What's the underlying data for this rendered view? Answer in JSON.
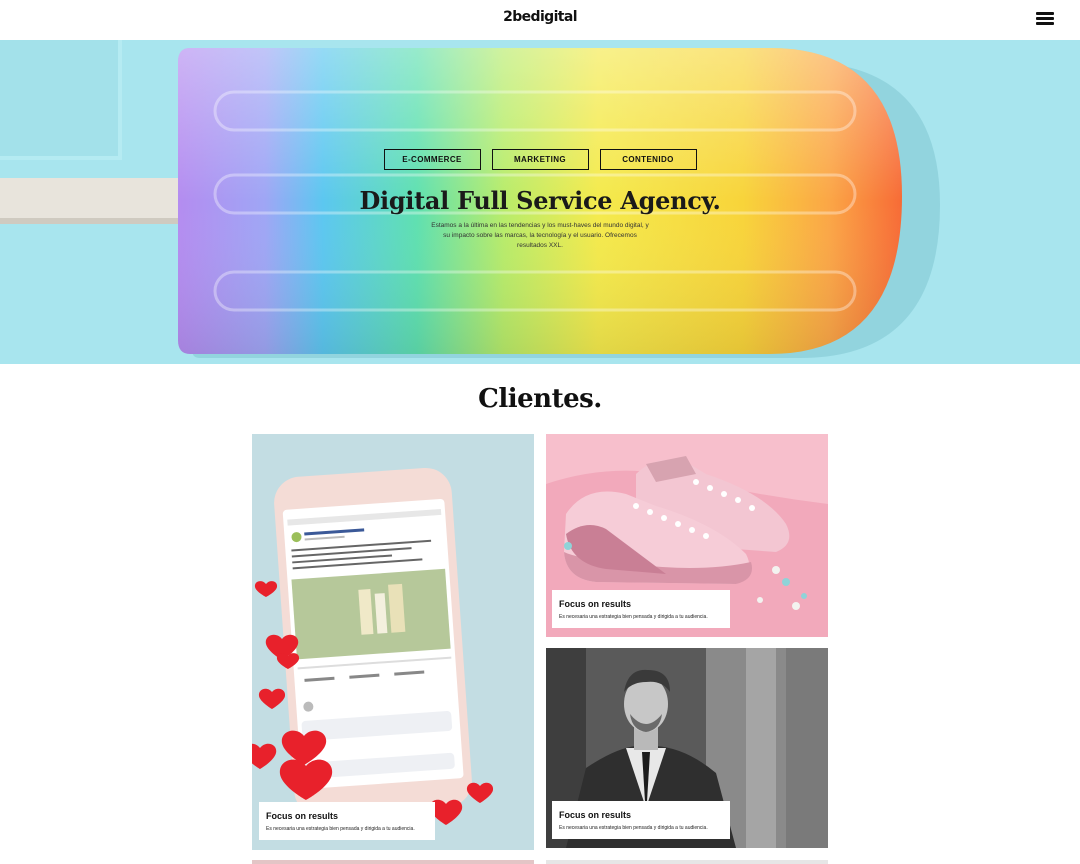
{
  "header": {
    "logo": "2bedigital"
  },
  "hero": {
    "tags": [
      "E-COMMERCE",
      "MARKETING",
      "CONTENIDO"
    ],
    "title": "Digital Full Service Agency.",
    "description": "Estamos a la última en las tendencias y los must-haves del mundo digital, y su impacto sobre las marcas, la tecnología y el usuario. Ofrecemos resultados XXL."
  },
  "clients": {
    "title": "Clientes.",
    "cards": [
      {
        "title": "Focus on results",
        "desc": "Es necesaria una estrategia bien pensada y dirigida a tu audiencia."
      },
      {
        "title": "Focus on results",
        "desc": "Es necesaria una estrategia bien pensada y dirigida a tu audiencia."
      },
      {
        "title": "Focus on results",
        "desc": "Es necesaria una estrategia bien pensada y dirigida a tu audiencia."
      }
    ]
  },
  "colors": {
    "hero_bg": "#a8e5ee",
    "text": "#111111",
    "card_1_bg": "#c3dde3",
    "card_2_bg": "#f2a9bb",
    "card_3_bg": "#6a6a6a"
  },
  "icons": {
    "menu": "hamburger-menu-icon"
  }
}
